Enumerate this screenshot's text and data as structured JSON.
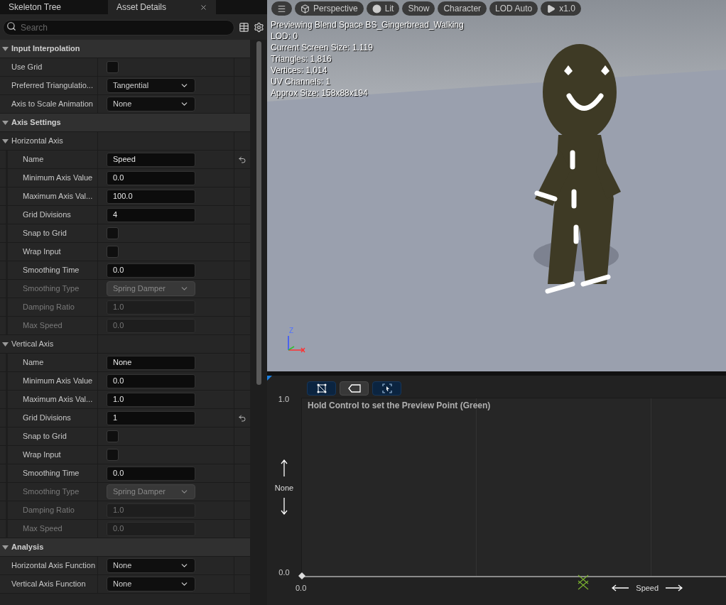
{
  "panel_tabs": [
    {
      "label": "Skeleton Tree",
      "selected": false,
      "closable": false
    },
    {
      "label": "Asset Details",
      "selected": true,
      "closable": true
    }
  ],
  "search": {
    "placeholder": "Search"
  },
  "properties": [
    {
      "kind": "category",
      "label": "Input Interpolation",
      "expanded": true,
      "children": [
        {
          "kind": "checkbox",
          "label": "Use Grid",
          "checked": false,
          "disabled": false
        },
        {
          "kind": "dropdown",
          "label": "Preferred Triangulatio...",
          "value": "Tangential",
          "disabled": false
        },
        {
          "kind": "dropdown",
          "label": "Axis to Scale Animation",
          "value": "None",
          "disabled": false
        }
      ]
    },
    {
      "kind": "category",
      "label": "Axis Settings",
      "expanded": true,
      "children": [
        {
          "kind": "group",
          "label": "Horizontal Axis",
          "expanded": true,
          "children": [
            {
              "kind": "text",
              "label": "Name",
              "value": "Speed",
              "disabled": false,
              "reset": true
            },
            {
              "kind": "text",
              "label": "Minimum Axis Value",
              "value": "0.0",
              "disabled": false,
              "reset": false
            },
            {
              "kind": "text",
              "label": "Maximum Axis Val...",
              "value": "100.0",
              "disabled": false,
              "reset": false
            },
            {
              "kind": "text",
              "label": "Grid Divisions",
              "value": "4",
              "disabled": false,
              "reset": false
            },
            {
              "kind": "checkbox",
              "label": "Snap to Grid",
              "checked": false,
              "disabled": false
            },
            {
              "kind": "checkbox",
              "label": "Wrap Input",
              "checked": false,
              "disabled": false
            },
            {
              "kind": "text",
              "label": "Smoothing Time",
              "value": "0.0",
              "disabled": false,
              "reset": false
            },
            {
              "kind": "dropdown",
              "label": "Smoothing Type",
              "value": "Spring Damper",
              "disabled": true
            },
            {
              "kind": "text",
              "label": "Damping Ratio",
              "value": "1.0",
              "disabled": true,
              "reset": false
            },
            {
              "kind": "text",
              "label": "Max Speed",
              "value": "0.0",
              "disabled": true,
              "reset": false
            }
          ]
        },
        {
          "kind": "group",
          "label": "Vertical Axis",
          "expanded": true,
          "children": [
            {
              "kind": "text",
              "label": "Name",
              "value": "None",
              "disabled": false,
              "reset": false
            },
            {
              "kind": "text",
              "label": "Minimum Axis Value",
              "value": "0.0",
              "disabled": false,
              "reset": false
            },
            {
              "kind": "text",
              "label": "Maximum Axis Val...",
              "value": "1.0",
              "disabled": false,
              "reset": false
            },
            {
              "kind": "text",
              "label": "Grid Divisions",
              "value": "1",
              "disabled": false,
              "reset": true
            },
            {
              "kind": "checkbox",
              "label": "Snap to Grid",
              "checked": false,
              "disabled": false
            },
            {
              "kind": "checkbox",
              "label": "Wrap Input",
              "checked": false,
              "disabled": false
            },
            {
              "kind": "text",
              "label": "Smoothing Time",
              "value": "0.0",
              "disabled": false,
              "reset": false
            },
            {
              "kind": "dropdown",
              "label": "Smoothing Type",
              "value": "Spring Damper",
              "disabled": true
            },
            {
              "kind": "text",
              "label": "Damping Ratio",
              "value": "1.0",
              "disabled": true,
              "reset": false
            },
            {
              "kind": "text",
              "label": "Max Speed",
              "value": "0.0",
              "disabled": true,
              "reset": false
            }
          ]
        }
      ]
    },
    {
      "kind": "category",
      "label": "Analysis",
      "expanded": true,
      "children": [
        {
          "kind": "dropdown",
          "label": "Horizontal Axis Function",
          "value": "None",
          "disabled": false
        },
        {
          "kind": "dropdown",
          "label": "Vertical Axis Function",
          "value": "None",
          "disabled": false
        }
      ]
    }
  ],
  "viewport": {
    "toolbar": [
      {
        "kind": "menu"
      },
      {
        "kind": "cube",
        "label": "Perspective"
      },
      {
        "kind": "sphere",
        "label": "Lit"
      },
      {
        "kind": "plain",
        "label": "Show"
      },
      {
        "kind": "plain",
        "label": "Character"
      },
      {
        "kind": "plain",
        "label": "LOD Auto"
      },
      {
        "kind": "play",
        "label": "x1.0"
      }
    ],
    "info_lines": [
      "Previewing Blend Space BS_Gingerbread_Walking",
      "LOD: 0",
      "Current Screen Size: 1.119",
      "Triangles: 1,816",
      "Vertices: 1,014",
      "UV Channels: 1",
      "Approx Size: 158x88x194"
    ],
    "gizmo": {
      "z": "Z"
    }
  },
  "blend_space": {
    "tools": [
      {
        "kind": "triangulation",
        "selected": true
      },
      {
        "kind": "label",
        "selected": false
      },
      {
        "kind": "fit",
        "selected": true
      }
    ],
    "hint": "Hold Control to set the Preview Point (Green)",
    "y_max": "1.0",
    "y_min": "0.0",
    "x_min": "0.0",
    "y_axis_name": "None",
    "x_axis_name": "Speed"
  }
}
